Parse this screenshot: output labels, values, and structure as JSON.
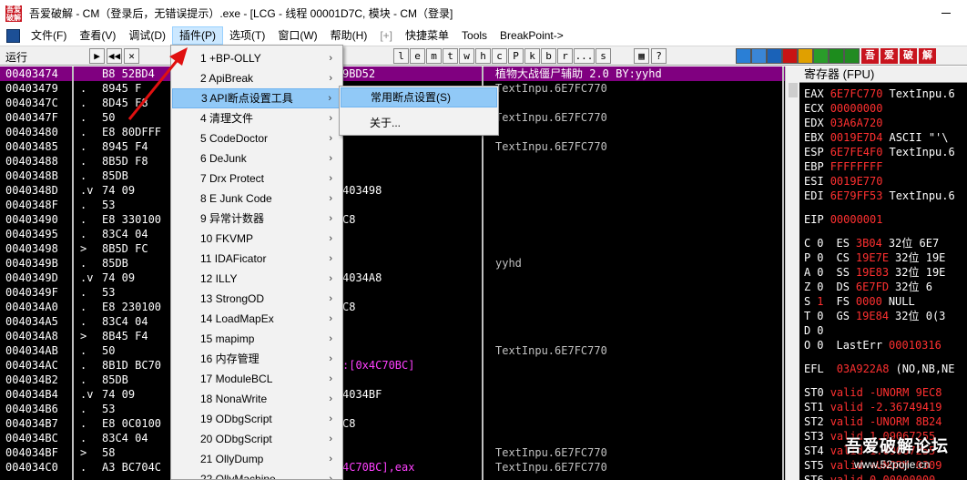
{
  "window": {
    "title": "吾爱破解 - CM（登录后，无错误提示）.exe - [LCG - 线程 00001D7C, 模块 - CM（登录]",
    "icon_text": "吾爱破解"
  },
  "menubar": [
    {
      "label": "文件(F)"
    },
    {
      "label": "查看(V)"
    },
    {
      "label": "调试(D)"
    },
    {
      "label": "插件(P)",
      "active": true
    },
    {
      "label": "选项(T)"
    },
    {
      "label": "窗口(W)"
    },
    {
      "label": "帮助(H)"
    },
    {
      "label": "[+]",
      "gray": true
    },
    {
      "label": "快捷菜单"
    },
    {
      "label": "Tools"
    },
    {
      "label": "BreakPoint->"
    }
  ],
  "toolbar": {
    "status": "运行",
    "letter_buttons": [
      "l",
      "e",
      "m",
      "t",
      "w",
      "h",
      "c",
      "P",
      "k",
      "b",
      "r",
      "...",
      "s"
    ],
    "nav_buttons": [
      "▶",
      "◀◀",
      "✕"
    ],
    "mid_buttons": [
      "▦",
      "?"
    ],
    "right_cn_buttons": [
      "吾",
      "爱",
      "破",
      "解"
    ],
    "right_colors": [
      "#2a7fd6",
      "#3a86d6",
      "#1a62b8",
      "#c81414",
      "#e0a000",
      "#2a9c2a",
      "#1d8c1d",
      "#228b22"
    ]
  },
  "colors": {
    "cpu_bg": "#000000",
    "selected_row": "#800080",
    "address": "#ffffff",
    "comment": "#c0c0c0",
    "register_red": "#ff3030",
    "highlight_blue": "#91c9f7",
    "jump_cyan": "#00ffff",
    "ref_magenta": "#ff40ff"
  },
  "cpu_rows": [
    {
      "addr": "00403474",
      "dot": "",
      "hex": "B8 52BD4",
      "asm": "9BD52",
      "comment": "植物大战僵尸辅助 2.0 BY:yyhd",
      "selected": true
    },
    {
      "addr": "00403479",
      "dot": ".",
      "hex": "8945 F",
      "asm": "",
      "comment": "TextInpu.6E7FC770"
    },
    {
      "addr": "0040347C",
      "dot": ".",
      "hex": "8D45 F8",
      "asm": "",
      "comment": ""
    },
    {
      "addr": "0040347F",
      "dot": ".",
      "hex": "50",
      "asm": "",
      "comment": "TextInpu.6E7FC770"
    },
    {
      "addr": "00403480",
      "dot": ".",
      "hex": "E8 80DFFF",
      "asm": "",
      "comment": ""
    },
    {
      "addr": "00403485",
      "dot": ".",
      "hex": "8945 F4",
      "asm": "",
      "comment": "TextInpu.6E7FC770"
    },
    {
      "addr": "00403488",
      "dot": ".",
      "hex": "8B5D F8",
      "asm": "",
      "comment": ""
    },
    {
      "addr": "0040348B",
      "dot": ".",
      "hex": "85DB",
      "asm": "",
      "comment": ""
    },
    {
      "addr": "0040348D",
      "dot": ".v",
      "hex": "74 09",
      "asm": "403498",
      "comment": ""
    },
    {
      "addr": "0040348F",
      "dot": ".",
      "hex": "53",
      "asm": "",
      "comment": ""
    },
    {
      "addr": "00403490",
      "dot": ".",
      "hex": "E8 330100",
      "asm": "C8",
      "comment": ""
    },
    {
      "addr": "00403495",
      "dot": ".",
      "hex": "83C4 04",
      "asm": "",
      "comment": ""
    },
    {
      "addr": "00403498",
      "dot": ">",
      "hex": "8B5D FC",
      "asm": "",
      "comment": ""
    },
    {
      "addr": "0040349B",
      "dot": ".",
      "hex": "85DB",
      "asm": "",
      "comment": "yyhd"
    },
    {
      "addr": "0040349D",
      "dot": ".v",
      "hex": "74 09",
      "asm": "4034A8",
      "comment": ""
    },
    {
      "addr": "0040349F",
      "dot": ".",
      "hex": "53",
      "asm": "",
      "comment": ""
    },
    {
      "addr": "004034A0",
      "dot": ".",
      "hex": "E8 230100",
      "asm": "C8",
      "comment": ""
    },
    {
      "addr": "004034A5",
      "dot": ".",
      "hex": "83C4 04",
      "asm": "",
      "comment": ""
    },
    {
      "addr": "004034A8",
      "dot": ">",
      "hex": "8B45 F4",
      "asm": "",
      "comment": ""
    },
    {
      "addr": "004034AB",
      "dot": ".",
      "hex": "50",
      "asm": "",
      "comment": "TextInpu.6E7FC770"
    },
    {
      "addr": "004034AC",
      "dot": ".",
      "hex": "8B1D BC70",
      "asm": ":[0x4C70BC]",
      "comment": ""
    },
    {
      "addr": "004034B2",
      "dot": ".",
      "hex": "85DB",
      "asm": "",
      "comment": ""
    },
    {
      "addr": "004034B4",
      "dot": ".v",
      "hex": "74 09",
      "asm": "4034BF",
      "comment": ""
    },
    {
      "addr": "004034B6",
      "dot": ".",
      "hex": "53",
      "asm": "",
      "comment": ""
    },
    {
      "addr": "004034B7",
      "dot": ".",
      "hex": "E8 0C0100",
      "asm": "C8",
      "comment": ""
    },
    {
      "addr": "004034BC",
      "dot": ".",
      "hex": "83C4 04",
      "asm": "",
      "comment": ""
    },
    {
      "addr": "004034BF",
      "dot": ">",
      "hex": "58",
      "asm": "",
      "comment": "TextInpu.6E7FC770"
    },
    {
      "addr": "004034C0",
      "dot": ".",
      "hex": "A3 BC704C",
      "asm": "4C70BC],eax",
      "comment": "TextInpu.6E7FC770"
    }
  ],
  "registers": {
    "header": "寄存器 (FPU)",
    "lines": [
      {
        "name": "EAX",
        "value": "6E7FC770",
        "extra": "TextInpu.6"
      },
      {
        "name": "ECX",
        "value": "00000000",
        "extra": ""
      },
      {
        "name": "EDX",
        "value": "03A6A720",
        "extra": ""
      },
      {
        "name": "EBX",
        "value": "0019E7D4",
        "extra": "ASCII \"'\\"
      },
      {
        "name": "ESP",
        "value": "6E7FE4F0",
        "extra": "TextInpu.6"
      },
      {
        "name": "EBP",
        "value": "FFFFFFFF",
        "extra": ""
      },
      {
        "name": "ESI",
        "value": "0019E770",
        "extra": ""
      },
      {
        "name": "EDI",
        "value": "6E79FF53",
        "extra": "TextInpu.6"
      },
      {
        "name": "EIP",
        "value": "00000001",
        "extra": ""
      }
    ],
    "flags": [
      {
        "f": "C",
        "v": "0",
        "seg": "ES",
        "sel": "3B04",
        "desc": "32位 6E7"
      },
      {
        "f": "P",
        "v": "0",
        "seg": "CS",
        "sel": "19E7E",
        "desc": "32位 19E"
      },
      {
        "f": "A",
        "v": "0",
        "seg": "SS",
        "sel": "19E83",
        "desc": "32位 19E"
      },
      {
        "f": "Z",
        "v": "0",
        "seg": "DS",
        "sel": "6E7FD",
        "desc": "32位 6"
      },
      {
        "f": "S",
        "v": "1",
        "seg": "FS",
        "sel": "0000",
        "desc": "NULL"
      },
      {
        "f": "T",
        "v": "0",
        "seg": "GS",
        "sel": "19E84",
        "desc": "32位 0(3"
      },
      {
        "f": "D",
        "v": "0",
        "seg": "",
        "sel": "",
        "desc": ""
      },
      {
        "f": "O",
        "v": "0",
        "seg": "LastErr",
        "sel": "00010316",
        "desc": ""
      }
    ],
    "efl": {
      "name": "EFL",
      "value": "03A922A8",
      "extra": "(NO,NB,NE"
    },
    "fpu": [
      {
        "name": "ST0",
        "value": "valid -UNORM 9EC8"
      },
      {
        "name": "ST1",
        "value": "valid -2.36749419"
      },
      {
        "name": "ST2",
        "value": "valid -UNORM 8B24"
      },
      {
        "name": "ST3",
        "value": "valid 1.09067255"
      },
      {
        "name": "ST4",
        "value": "valid 1.09067255"
      },
      {
        "name": "ST5",
        "value": "valid +UNORM 0309"
      },
      {
        "name": "ST6",
        "value": "valid 0.00000000"
      }
    ]
  },
  "plugin_menu": [
    {
      "label": "1 +BP-OLLY"
    },
    {
      "label": "2 ApiBreak"
    },
    {
      "label": "3 API断点设置工具",
      "highlighted": true
    },
    {
      "label": "4 清理文件"
    },
    {
      "label": "5 CodeDoctor"
    },
    {
      "label": "6 DeJunk"
    },
    {
      "label": "7 Drx Protect"
    },
    {
      "label": "8 E Junk Code"
    },
    {
      "label": "9 异常计数器"
    },
    {
      "label": "10 FKVMP"
    },
    {
      "label": "11 IDAFicator"
    },
    {
      "label": "12 ILLY"
    },
    {
      "label": "13 StrongOD"
    },
    {
      "label": "14 LoadMapEx"
    },
    {
      "label": "15 mapimp"
    },
    {
      "label": "16 内存管理"
    },
    {
      "label": "17 ModuleBCL"
    },
    {
      "label": "18 NonaWrite"
    },
    {
      "label": "19 ODbgScript"
    },
    {
      "label": "20 ODbgScript"
    },
    {
      "label": "21 OllyDump"
    },
    {
      "label": "22 OllyMachine"
    }
  ],
  "api_submenu": [
    {
      "label": "常用断点设置(S)",
      "highlighted": true
    },
    {
      "label": "关于..."
    }
  ],
  "watermark": {
    "line1": "吾爱破解论坛",
    "line2": "www.52pojie.cn"
  }
}
